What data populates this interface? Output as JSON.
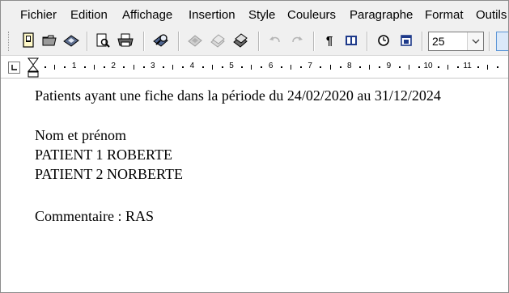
{
  "menu": {
    "items": [
      "Fichier",
      "Edition",
      "Affichage",
      "Insertion",
      "Style",
      "Couleurs",
      "Paragraphe",
      "Format",
      "Outils"
    ]
  },
  "toolbar": {
    "icons": [
      "new-document-icon",
      "open-folder-icon",
      "save-icon",
      "print-preview-icon",
      "print-icon",
      "find-icon",
      "cut-icon",
      "copy-icon",
      "paste-icon",
      "undo-icon",
      "redo-icon",
      "pilcrow-icon",
      "page-break-icon",
      "clock-icon",
      "calendar-icon"
    ],
    "pilcrow_glyph": "¶",
    "font_size_value": "25"
  },
  "ruler": {
    "numbers": [
      "1",
      "2",
      "3",
      "4",
      "5",
      "6",
      "7",
      "8",
      "9",
      "10",
      "11"
    ]
  },
  "document": {
    "lines": [
      "Patients ayant une fiche dans la période du 24/02/2020 au 31/12/2024",
      "Nom et prénom",
      "PATIENT 1 ROBERTE",
      "PATIENT 2 NORBERTE",
      "Commentaire : RAS"
    ]
  }
}
